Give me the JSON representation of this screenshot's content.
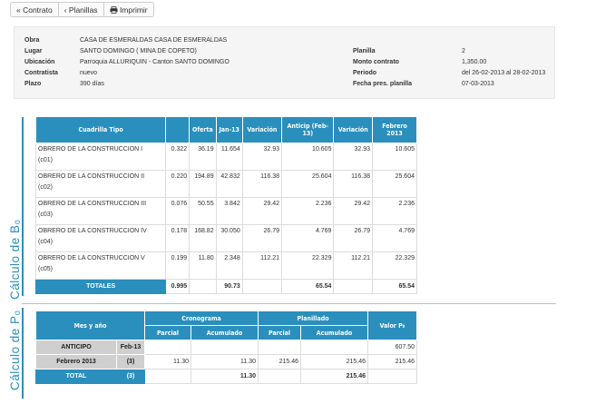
{
  "toolbar": {
    "contrato": "« Contrato",
    "planillas": "‹ Planillas",
    "imprimir": "Imprimir"
  },
  "info": {
    "obra_label": "Obra",
    "obra": "CASA DE ESMERALDAS CASA DE ESMERALDAS",
    "lugar_label": "Lugar",
    "lugar": "SANTO DOMINGO ( MINA DE COPETO)",
    "ubicacion_label": "Ubicación",
    "ubicacion": "Parroquia ALLURIQUIN - Canton SANTO DOMINGO",
    "contratista_label": "Contratista",
    "contratista": "nuevo",
    "plazo_label": "Plazo",
    "plazo": "390 días",
    "planilla_label": "Planilla",
    "planilla": "2",
    "monto_label": "Monto contrato",
    "monto": "1,350.00",
    "periodo_label": "Periodo",
    "periodo": "del 26-02-2013 al 28-02-2013",
    "fecha_label": "Fecha pres. planilla",
    "fecha": "07-03-2013"
  },
  "section_b": {
    "label": "Cálculo de B₀",
    "headers": {
      "cuadrilla": "Cuadrilla Tipo",
      "oferta": "Oferta",
      "jan13": "Jan-13",
      "variacion1": "Variación",
      "anticipo": "Anticip (Feb-13)",
      "variacion2": "Variación",
      "febrero": "Febrero 2013"
    },
    "rows": [
      {
        "name": "OBRERO DE LA CONSTRUCCION I",
        "code": "(c01)",
        "coef": "0.322",
        "oferta": "36.19",
        "jan": "11.654",
        "var1": "32.93",
        "ant": "10.605",
        "var2": "32.93",
        "feb": "10.605"
      },
      {
        "name": "OBRERO DE LA CONSTRUCCION II",
        "code": "(c02)",
        "coef": "0.220",
        "oferta": "194.89",
        "jan": "42.832",
        "var1": "116.38",
        "ant": "25.604",
        "var2": "116.38",
        "feb": "25.604"
      },
      {
        "name": "OBRERO DE LA CONSTRUCCION III",
        "code": "(c03)",
        "coef": "0.076",
        "oferta": "50.55",
        "jan": "3.842",
        "var1": "29.42",
        "ant": "2.236",
        "var2": "29.42",
        "feb": "2.236"
      },
      {
        "name": "OBRERO DE LA CONSTRUCCION IV",
        "code": "(c04)",
        "coef": "0.178",
        "oferta": "168.82",
        "jan": "30.050",
        "var1": "26.79",
        "ant": "4.769",
        "var2": "26.79",
        "feb": "4.769"
      },
      {
        "name": "OBRERO DE LA CONSTRUCCION V",
        "code": "(c05)",
        "coef": "0.199",
        "oferta": "11.80",
        "jan": "2.348",
        "var1": "112.21",
        "ant": "22.329",
        "var2": "112.21",
        "feb": "22.329"
      }
    ],
    "totals": {
      "label": "TOTALES",
      "coef": "0.995",
      "jan": "90.73",
      "ant": "65.54",
      "feb": "65.54"
    }
  },
  "section_p": {
    "label": "Cálculo de P₀",
    "headers": {
      "mes": "Mes y año",
      "cronograma": "Cronograma",
      "planillado": "Planillado",
      "valor": "Valor P₀",
      "parcial1": "Parcial",
      "acumulado1": "Acumulado",
      "parcial2": "Parcial",
      "acumulado2": "Acumulado"
    },
    "rows": [
      {
        "mes": "ANTICIPO",
        "sub": "Feb-13",
        "cparcial": "",
        "cacum": "",
        "pparcial": "",
        "pacum": "",
        "valor": "607.50"
      },
      {
        "mes": "Febrero 2013",
        "sub": "(3)",
        "cparcial": "11.30",
        "cacum": "11.30",
        "pparcial": "215.46",
        "pacum": "215.46",
        "valor": "215.46"
      }
    ],
    "total": {
      "mes": "TOTAL",
      "sub": "(3)",
      "cacum": "11.30",
      "pacum": "215.46"
    }
  }
}
